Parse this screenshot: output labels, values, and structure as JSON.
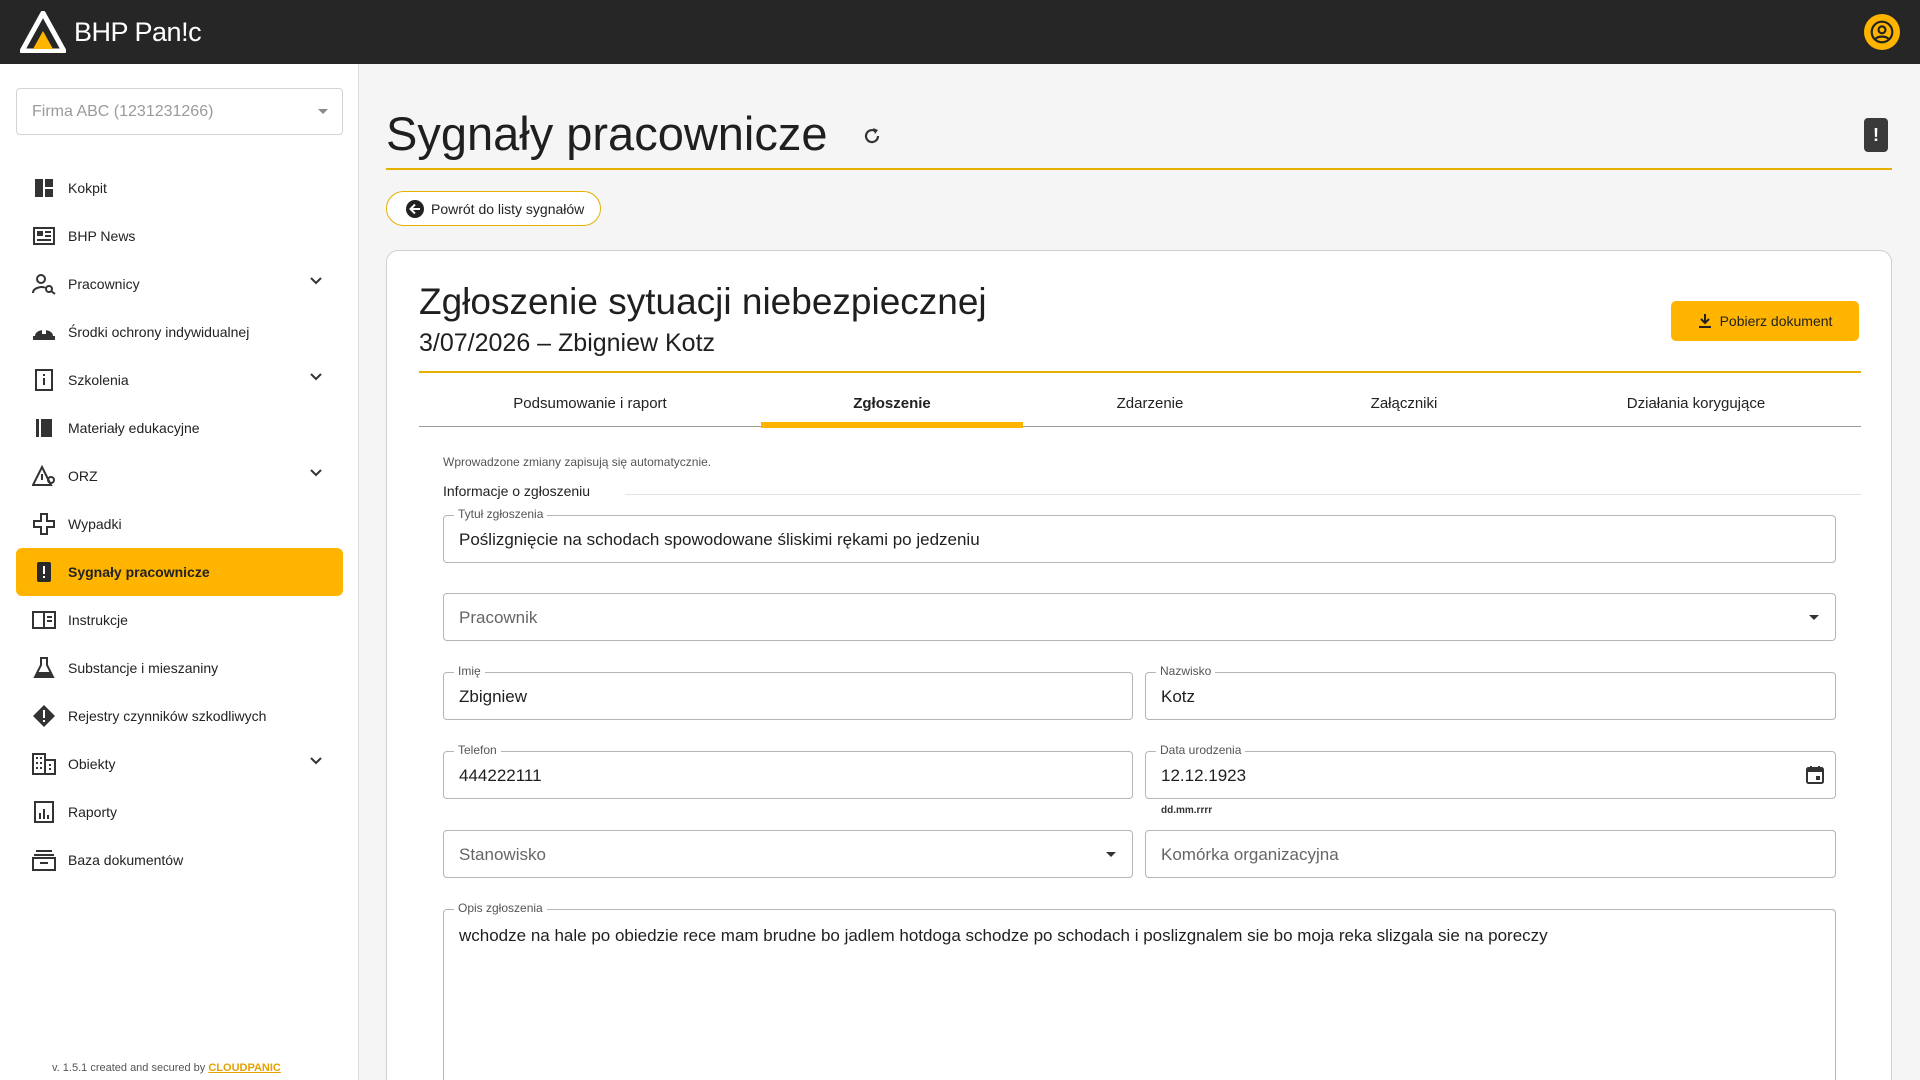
{
  "app": {
    "logo_text": "BHP Pan!c"
  },
  "sidebar": {
    "company_select": "Firma ABC (1231231266)",
    "items": [
      {
        "label": "Kokpit",
        "icon": "dashboard-icon",
        "expandable": false
      },
      {
        "label": "BHP News",
        "icon": "newspaper-icon",
        "expandable": false
      },
      {
        "label": "Pracownicy",
        "icon": "person-search-icon",
        "expandable": true
      },
      {
        "label": "Środki ochrony indywidualnej",
        "icon": "helmet-icon",
        "expandable": false
      },
      {
        "label": "Szkolenia",
        "icon": "training-book-icon",
        "expandable": true
      },
      {
        "label": "Materiały edukacyjne",
        "icon": "book-icon",
        "expandable": false
      },
      {
        "label": "ORZ",
        "icon": "risk-triangle-icon",
        "expandable": true
      },
      {
        "label": "Wypadki",
        "icon": "medical-icon",
        "expandable": false
      },
      {
        "label": "Sygnały pracownicze",
        "icon": "signal-alert-icon",
        "expandable": false,
        "active": true
      },
      {
        "label": "Instrukcje",
        "icon": "instructions-icon",
        "expandable": false
      },
      {
        "label": "Substancje i mieszaniny",
        "icon": "flask-icon",
        "expandable": false
      },
      {
        "label": "Rejestry czynników szkodliwych",
        "icon": "warning-diamond-icon",
        "expandable": false
      },
      {
        "label": "Obiekty",
        "icon": "building-icon",
        "expandable": true
      },
      {
        "label": "Raporty",
        "icon": "report-icon",
        "expandable": false
      },
      {
        "label": "Baza dokumentów",
        "icon": "archive-icon",
        "expandable": false
      }
    ],
    "version_text": "v. 1.5.1 created and secured by ",
    "version_brand": "CLOUDPANIC"
  },
  "page": {
    "title": "Sygnały pracownicze",
    "back_button": "Powrót do listy sygnałów"
  },
  "card": {
    "title": "Zgłoszenie sytuacji niebezpiecznej",
    "subtitle": "3/07/2026 – Zbigniew Kotz",
    "download_button": "Pobierz dokument",
    "tabs": [
      {
        "label": "Podsumowanie i raport",
        "active": false
      },
      {
        "label": "Zgłoszenie",
        "active": true
      },
      {
        "label": "Zdarzenie",
        "active": false
      },
      {
        "label": "Załączniki",
        "active": false
      },
      {
        "label": "Działania korygujące",
        "active": false
      }
    ],
    "autosave_note": "Wprowadzone zmiany zapisują się automatycznie.",
    "section_label": "Informacje o zgłoszeniu"
  },
  "form": {
    "title": {
      "label": "Tytuł zgłoszenia",
      "value": "Poślizgnięcie na schodach spowodowane śliskimi rękami po jedzeniu"
    },
    "employee": {
      "placeholder": "Pracownik"
    },
    "first_name": {
      "label": "Imię",
      "value": "Zbigniew"
    },
    "last_name": {
      "label": "Nazwisko",
      "value": "Kotz"
    },
    "phone": {
      "label": "Telefon",
      "value": "444222111"
    },
    "birth_date": {
      "label": "Data urodzenia",
      "value": "12.12.1923",
      "helper": "dd.mm.rrrr"
    },
    "position": {
      "placeholder": "Stanowisko"
    },
    "org_unit": {
      "placeholder": "Komórka organizacyjna"
    },
    "description": {
      "label": "Opis zgłoszenia",
      "value": "wchodze na hale po obiedzie rece mam brudne bo jadlem hotdoga schodze po schodach i poslizgnalem sie bo moja reka slizgala sie na poreczy"
    }
  },
  "colors": {
    "accent": "#ffb400",
    "topbar": "#262626",
    "divider": "#e5b000"
  }
}
